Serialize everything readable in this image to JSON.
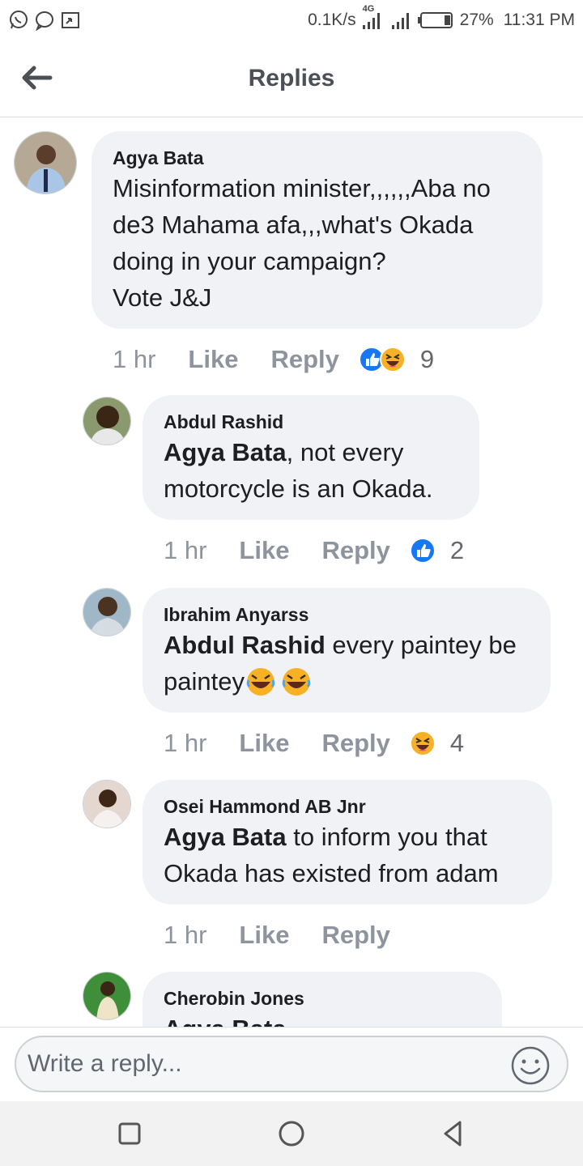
{
  "status_bar": {
    "speed": "0.1K/s",
    "network": "4G",
    "battery": "27%",
    "time": "11:31 PM"
  },
  "header": {
    "title": "Replies"
  },
  "comments": [
    {
      "author": "Agya Bata",
      "lines": [
        "Misinformation minister,,,,,,Aba no",
        "de3 Mahama afa,,,what's Okada",
        "doing in your campaign?",
        "Vote J&J"
      ],
      "time": "1 hr",
      "like": "Like",
      "reply": "Reply",
      "reaction_count": "9"
    },
    {
      "author": "Abdul Rashid",
      "mention": "Agya Bata",
      "line1_rest": ", not every",
      "line2": "motorcycle is an Okada.",
      "time": "1 hr",
      "like": "Like",
      "reply": "Reply",
      "reaction_count": "2"
    },
    {
      "author": "Ibrahim Anyarss",
      "mention": "Abdul Rashid",
      "line1_rest": " every paintey be",
      "line2": "paintey",
      "time": "1 hr",
      "like": "Like",
      "reply": "Reply",
      "reaction_count": "4"
    },
    {
      "author": "Osei Hammond AB Jnr",
      "mention": "Agya Bata",
      "line1_rest": " to inform you that",
      "line2": "Okada has existed from adam",
      "time": "1 hr",
      "like": "Like",
      "reply": "Reply"
    },
    {
      "author": "Cherobin Jones",
      "partial": "Agya Bata"
    }
  ],
  "composer": {
    "placeholder": "Write a reply..."
  },
  "colors": {
    "like_blue": "#1877f2",
    "bubble": "#f0f2f5",
    "muted": "#8d949e"
  }
}
